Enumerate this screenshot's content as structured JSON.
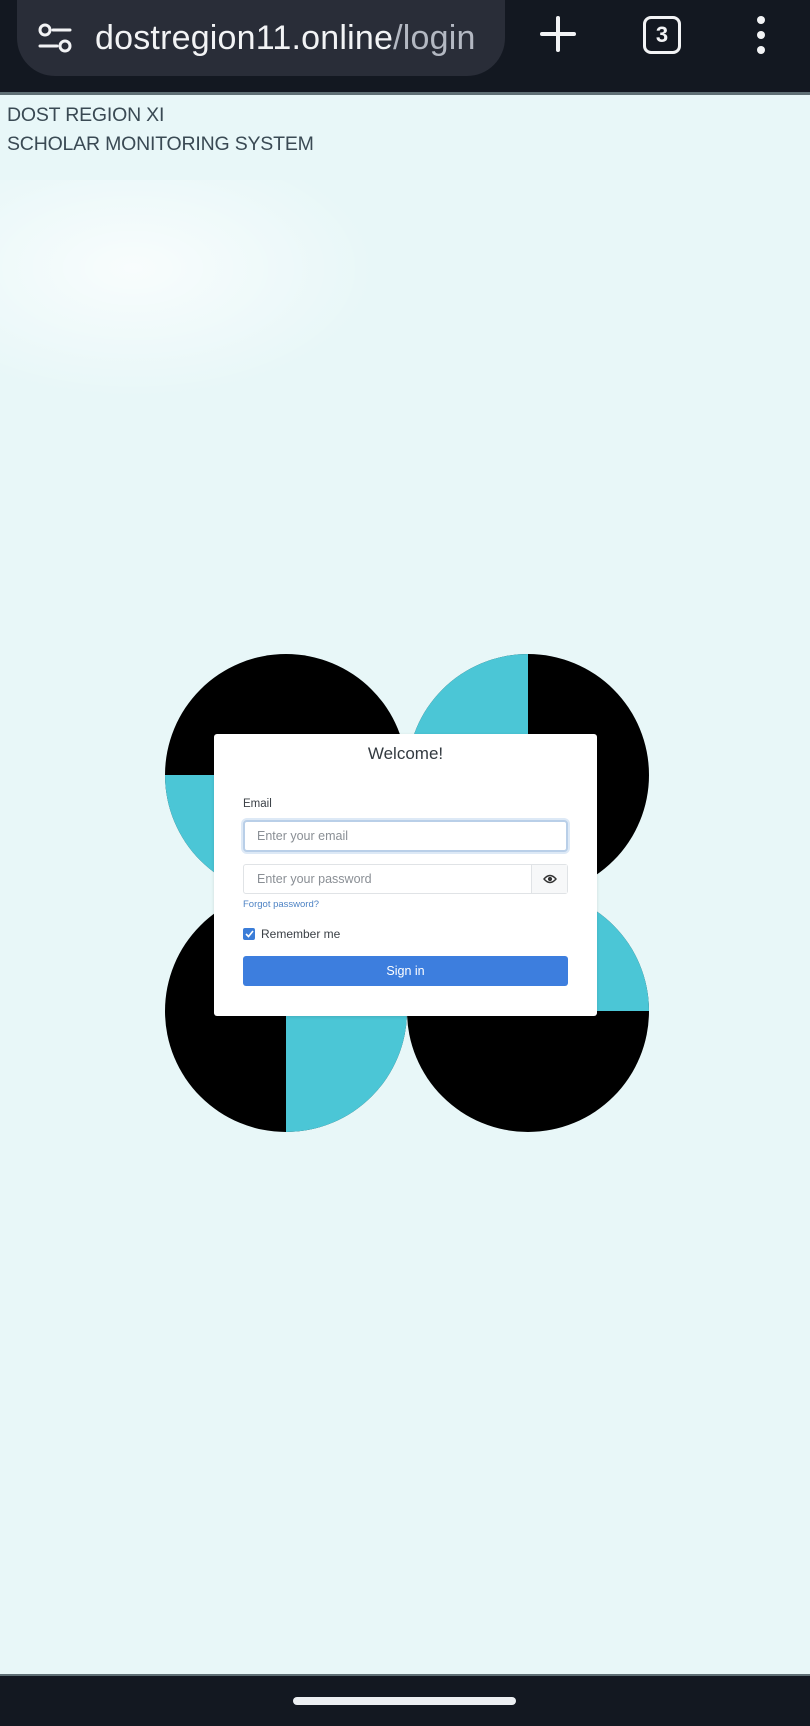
{
  "browser": {
    "url_domain": "dostregion11.online",
    "url_path": "/login",
    "tab_count": "3",
    "icons": [
      "site-settings-icon",
      "plus-icon",
      "tab-switcher-icon",
      "more-vert-icon"
    ]
  },
  "page": {
    "org_line1": "DOST REGION XI",
    "org_line2": "SCHOLAR MONITORING SYSTEM",
    "background_color": "#e8f7f8"
  },
  "logo": {
    "colors": {
      "dark": "#000000",
      "accent": "#4bc6d6"
    }
  },
  "login": {
    "title": "Welcome!",
    "email_label": "Email",
    "email_placeholder": "Enter your email",
    "email_value": "",
    "password_placeholder": "Enter your password",
    "password_value": "",
    "password_toggle_icon": "eye-icon",
    "forgot_password": "Forgot password?",
    "remember_me": "Remember me",
    "remember_checked": true,
    "sign_in": "Sign in",
    "accent_color": "#3d7ede"
  }
}
